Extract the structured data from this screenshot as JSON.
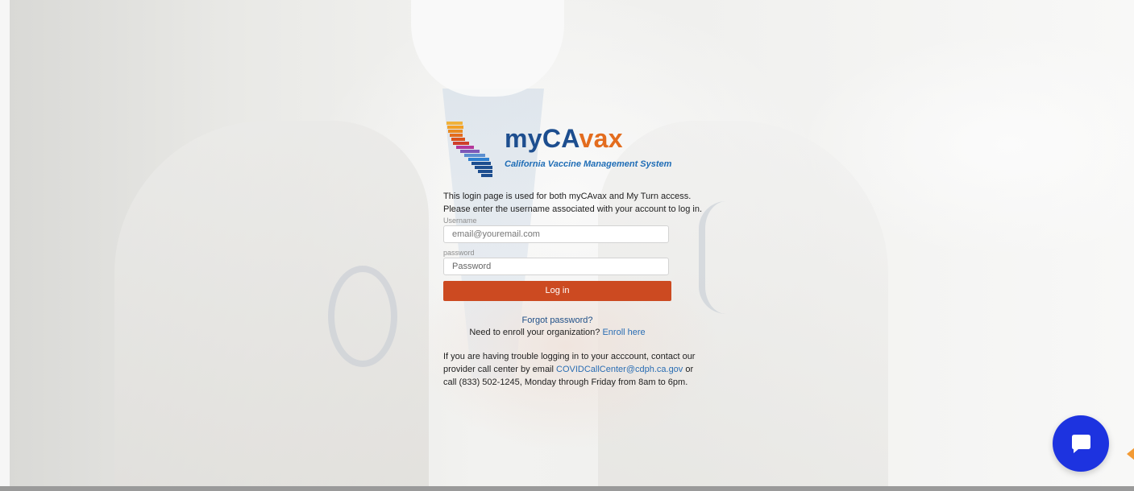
{
  "brand": {
    "logo_part1": "my",
    "logo_part2": "CA",
    "logo_part3": "vax",
    "subtitle": "California Vaccine Management System"
  },
  "login": {
    "intro_line1": "This login page is used for both myCAvax and My Turn access.",
    "intro_line2": "Please enter the username associated with your account to log in.",
    "username_label": "Username",
    "username_placeholder": "email@youremail.com",
    "password_label": "password",
    "password_placeholder": "Password",
    "login_button": "Log in",
    "forgot_password": "Forgot password?",
    "enroll_prefix": "Need to enroll your organization?",
    "enroll_link": "Enroll here",
    "help_line1": "If you are having trouble logging in to your acccount, contact our",
    "help_line2_prefix": "provider call center by email",
    "help_email": "COVIDCallCenter@cdph.ca.gov",
    "help_line2_suffix": "or",
    "help_line3": "call (833) 502-1245, Monday through Friday from 8am to 6pm."
  },
  "chat": {
    "icon": "chat-bubble-icon"
  },
  "colors": {
    "brand_blue": "#1d4e8f",
    "brand_orange": "#e36c1e",
    "button_red": "#cc4a21",
    "chat_blue": "#1d33e0",
    "link_blue": "#2a6db3"
  }
}
